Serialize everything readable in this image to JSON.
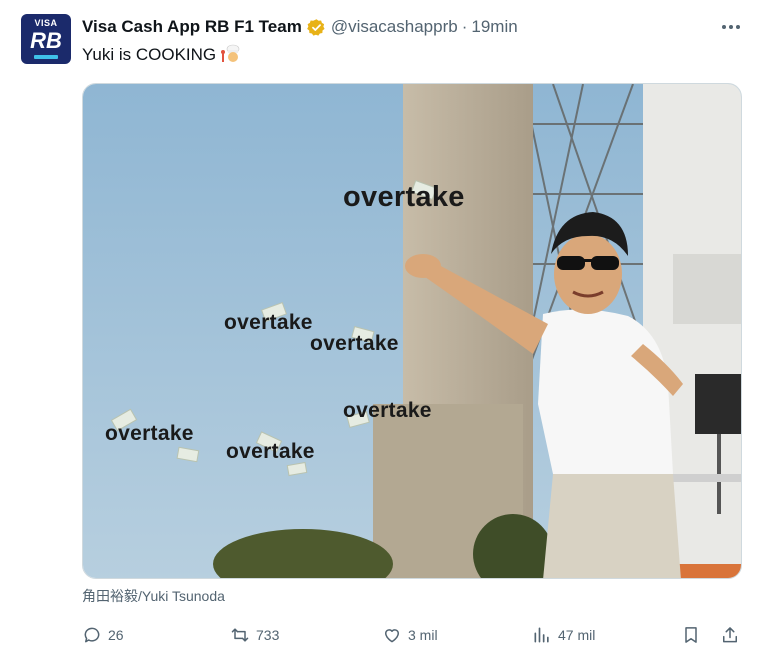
{
  "tweet": {
    "author_name": "Visa Cash App RB F1 Team",
    "handle": "@visacashapprb",
    "separator": "·",
    "time": "19min",
    "text": "Yuki is COOKING",
    "avatar": {
      "line1": "VISA",
      "line2": "RB"
    },
    "verified_badge_color": "#e8b217"
  },
  "media": {
    "overlay_words": [
      "overtake",
      "overtake",
      "overtake",
      "overtake",
      "overtake",
      "overtake"
    ],
    "caption": "角田裕毅/Yuki Tsunoda"
  },
  "actions": {
    "replies": "26",
    "reposts": "733",
    "likes": "3 mil",
    "views": "47 mil"
  },
  "icons": [
    "verified-badge-icon",
    "more-icon",
    "chef-emoji-icon",
    "reply-icon",
    "repost-icon",
    "like-icon",
    "views-icon",
    "bookmark-icon",
    "share-icon"
  ]
}
